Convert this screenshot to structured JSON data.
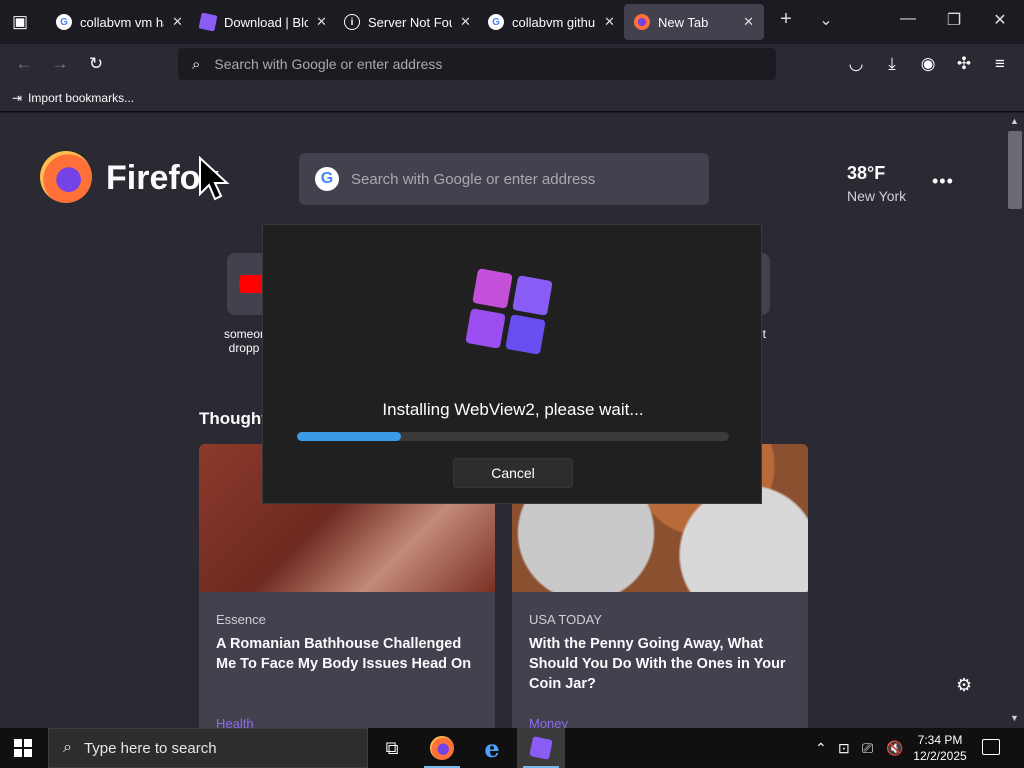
{
  "tabs": [
    {
      "title": "collabvm vm ha",
      "icon": "google-icon"
    },
    {
      "title": "Download | Blox",
      "icon": "bloxstrap-icon"
    },
    {
      "title": "Server Not Foun",
      "icon": "info-icon"
    },
    {
      "title": "collabvm github",
      "icon": "google-icon"
    },
    {
      "title": "New Tab",
      "icon": "firefox-icon",
      "active": true
    }
  ],
  "toolbar": {
    "address_placeholder": "Search with Google or enter address",
    "import_bookmarks": "Import bookmarks..."
  },
  "newtab": {
    "brand": "Firefox",
    "search_placeholder": "Search with Google or enter address",
    "weather_temp": "38°F",
    "weather_city": "New York",
    "shortcut_left_label_1": "someor",
    "shortcut_left_label_2": "dropp",
    "shortcut_right_label": "rut",
    "section_heading": "Thought",
    "cards": [
      {
        "source": "Essence",
        "title": "A Romanian Bathhouse Challenged Me To Face My Body Issues Head On",
        "category": "Health"
      },
      {
        "source": "USA TODAY",
        "title": "With the Penny Going Away, What Should You Do With the Ones in Your Coin Jar?",
        "category": "Money"
      }
    ]
  },
  "dialog": {
    "message": "Installing WebView2, please wait...",
    "progress_fraction": 0.24,
    "cancel_label": "Cancel"
  },
  "taskbar": {
    "search_placeholder": "Type here to search",
    "time": "7:34 PM",
    "date": "12/2/2025"
  },
  "colors": {
    "accent": "#3c9be8",
    "pocket_category": "#8c6eea"
  }
}
